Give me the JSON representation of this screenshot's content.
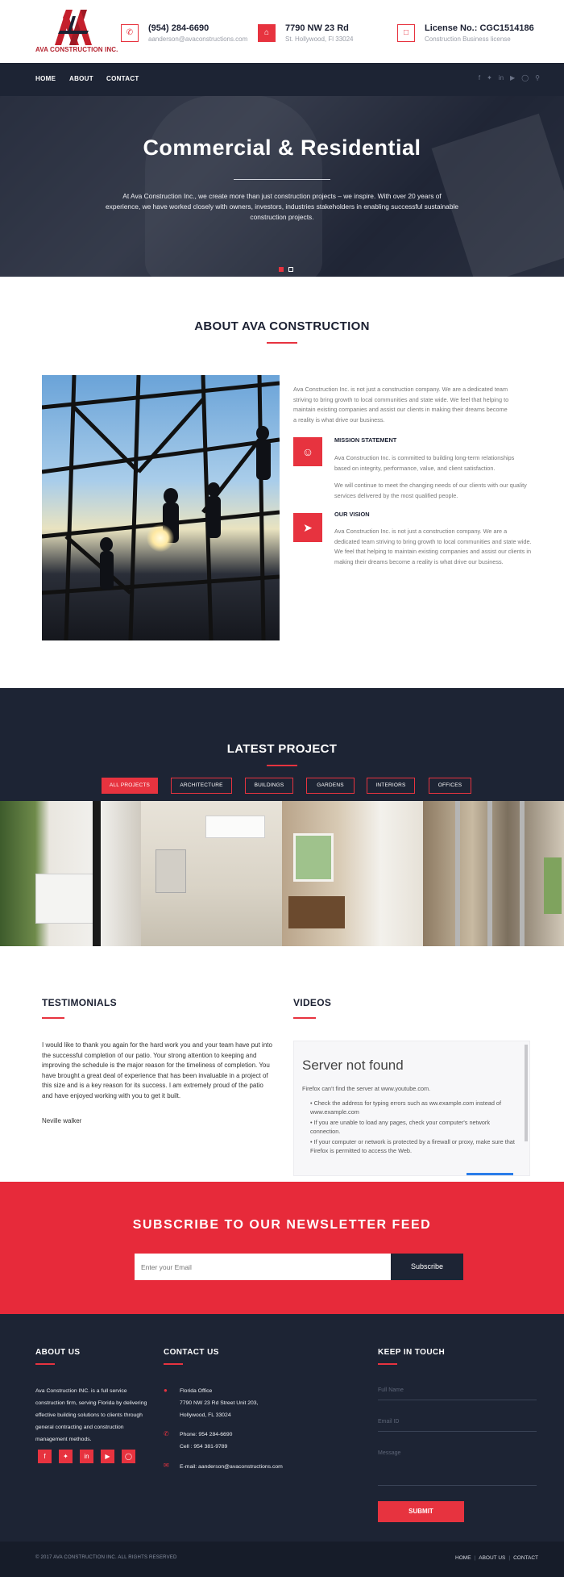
{
  "brand": {
    "name": "AVA CONSTRUCTION INC."
  },
  "header": {
    "phone": {
      "title": "(954) 284-6690",
      "sub": "aanderson@avaconstructions.com",
      "icon": "phone-icon"
    },
    "address": {
      "title": "7790 NW 23 Rd",
      "sub": "St. Hollywood, Fl 33024",
      "icon": "home-icon"
    },
    "license": {
      "title": "License No.: CGC1514186",
      "sub": "Construction Business license",
      "icon": "document-icon"
    }
  },
  "nav": {
    "links": [
      "HOME",
      "ABOUT",
      "CONTACT"
    ],
    "icons": [
      "facebook-icon",
      "twitter-icon",
      "linkedin-icon",
      "youtube-icon",
      "instagram-icon",
      "search-icon"
    ]
  },
  "hero": {
    "title": "Commercial & Residential",
    "text": "At Ava Construction Inc., we create more than just construction projects – we inspire. With over 20 years of experience, we have worked closely with owners, investors, industries stakeholders in enabling successful sustainable construction projects.",
    "slides": 2,
    "active_slide": 1
  },
  "about": {
    "title": "ABOUT AVA CONSTRUCTION",
    "intro": "Ava Construction Inc. is not just a construction company. We are a dedicated team striving to bring growth to local communities and state wide. We feel that helping to maintain existing companies and assist our clients in making their dreams become a reality is what drive our business.",
    "mission_title": "MISSION STATEMENT",
    "mission_p1": "Ava Construction Inc. is committed to building long-term relationships based on integrity, performance, value, and client satisfaction.",
    "mission_p2": "We will continue to meet the changing needs of our clients with our quality services delivered by the most qualified people.",
    "vision_title": "OUR VISION",
    "vision_text": "Ava Construction Inc. is not just a construction company. We are a dedicated team striving to bring growth to local communities and state wide. We feel that helping to maintain existing companies and assist our clients in making their dreams become a reality is what drive our business."
  },
  "projects": {
    "title": "LATEST PROJECT",
    "filters": [
      "ALL PROJECTS",
      "ARCHITECTURE",
      "BUILDINGS",
      "GARDENS",
      "INTERIORS",
      "OFFICES"
    ],
    "active_filter": "ALL PROJECTS"
  },
  "testimonials": {
    "title": "TESTIMONIALS",
    "quote": "I would like to thank you again for the hard work you and your team have put into the successful completion of our patio. Your strong attention to keeping and improving the schedule is the major reason for the timeliness of completion. You have brought a great deal of experience that has been invaluable in a project of this size and is a key reason for its success. I am extremely proud of the patio and have enjoyed working with you to get it built.",
    "author": "Neville walker"
  },
  "videos": {
    "title": "VIDEOS",
    "error_title": "Server not found",
    "error_line": "Firefox can't find the server at www.youtube.com.",
    "bullets": [
      "Check the address for typing errors such as ww.example.com instead of www.example.com",
      "If you are unable to load any pages, check your computer's network connection.",
      "If your computer or network is protected by a firewall or proxy, make sure that Firefox is permitted to access the Web."
    ]
  },
  "newsletter": {
    "title": "SUBSCRIBE TO OUR NEWSLETTER FEED",
    "placeholder": "Enter your Email",
    "button": "Subscribe"
  },
  "footer": {
    "about_title": "ABOUT US",
    "about_text": "Ava Construction INC. is a full service construction firm, serving Florida by delivering effective building solutions to clients through general contracting and construction management methods.",
    "social": [
      "facebook-icon",
      "twitter-icon",
      "linkedin-icon",
      "youtube-icon",
      "instagram-icon"
    ],
    "contact_title": "CONTACT US",
    "office_label": "Florida Office",
    "office_line1": "7790 NW 23 Rd Street Unit 203,",
    "office_line2": "Hollywood, FL 33024",
    "phone": "Phone: 954 284-6690",
    "cell": "Cell : 954 381-9789",
    "email": "E-mail: aanderson@avaconstructions.com",
    "touch_title": "KEEP IN TOUCH",
    "name_placeholder": "Full Name",
    "email_placeholder": "Email ID",
    "message_placeholder": "Message",
    "submit": "SUBMIT",
    "copyright": "© 2017 AVA CONSTRUCTION INC. ALL RIGHTS RESERVED",
    "bottom_links": [
      "HOME",
      "ABOUT US",
      "CONTACT"
    ]
  },
  "colors": {
    "accent": "#e7333f",
    "dark": "#1d2434",
    "newsletter": "#e72a3a"
  }
}
